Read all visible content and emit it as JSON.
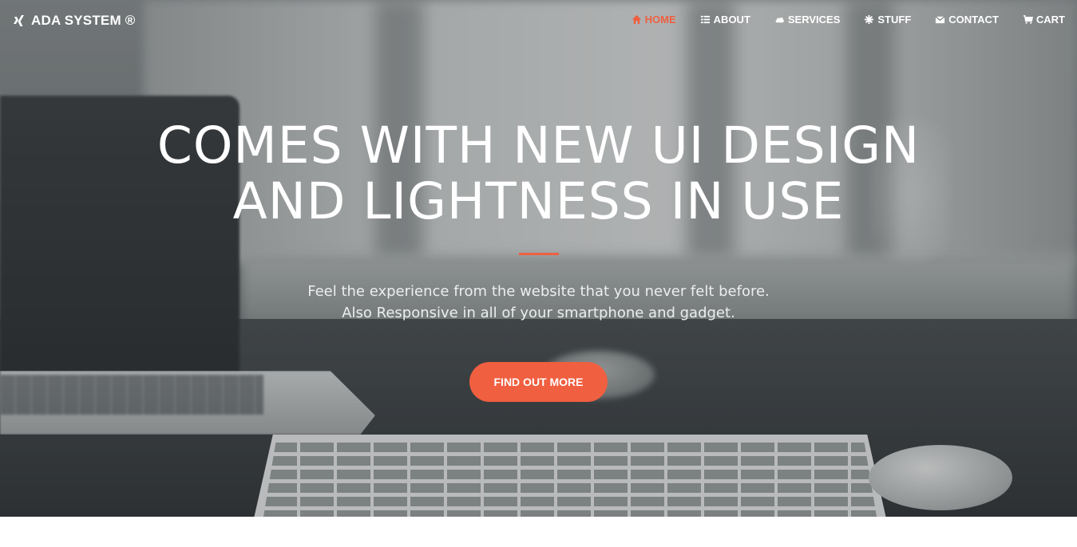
{
  "brand": {
    "name": "ADA SYSTEM ®",
    "icon": "xing-icon"
  },
  "nav": {
    "items": [
      {
        "label": "HOME",
        "icon": "home-icon",
        "active": true
      },
      {
        "label": "ABOUT",
        "icon": "list-icon",
        "active": false
      },
      {
        "label": "SERVICES",
        "icon": "cloud-icon",
        "active": false
      },
      {
        "label": "STUFF",
        "icon": "asterisk-icon",
        "active": false
      },
      {
        "label": "CONTACT",
        "icon": "envelope-icon",
        "active": false
      },
      {
        "label": "CART",
        "icon": "cart-icon",
        "active": false
      }
    ]
  },
  "hero": {
    "headline_line1": "COMES WITH NEW UI DESIGN",
    "headline_line2": "AND LIGHTNESS IN USE",
    "sub_line1": "Feel the experience from the website that you never felt before.",
    "sub_line2": "Also Responsive in all of your smartphone and gadget.",
    "cta_label": "FIND OUT MORE"
  },
  "colors": {
    "accent": "#f05f40",
    "text": "#ffffff"
  }
}
